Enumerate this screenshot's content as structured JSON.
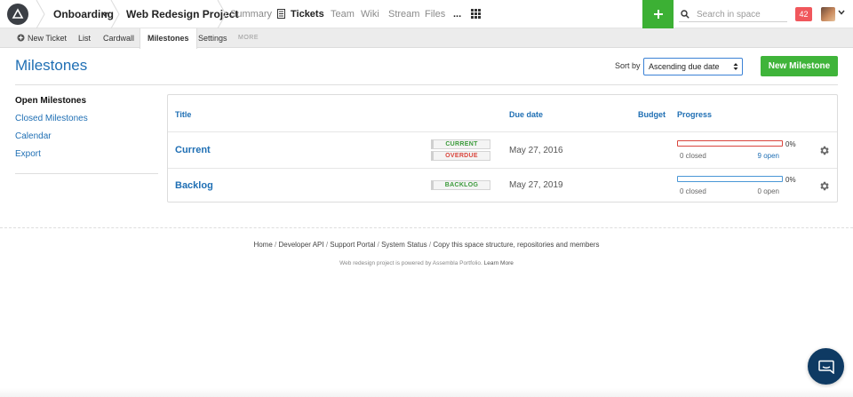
{
  "topbar": {
    "breadcrumbs": [
      "Onboarding",
      "Web Redesign Project"
    ],
    "nav": [
      {
        "label": "Summary",
        "active": false
      },
      {
        "label": "Tickets",
        "active": true
      },
      {
        "label": "Team",
        "active": false
      },
      {
        "label": "Wiki",
        "active": false
      },
      {
        "label": "Stream",
        "active": false
      },
      {
        "label": "Files",
        "active": false
      },
      {
        "label": "...",
        "active": false
      }
    ],
    "search_placeholder": "Search in space",
    "notification_count": "42",
    "plus_color": "#3cb034"
  },
  "subnav": {
    "new_ticket": "New Ticket",
    "items": [
      "List",
      "Cardwall",
      "Milestones",
      "Settings"
    ],
    "active": "Milestones",
    "more": "MORE"
  },
  "header": {
    "title": "Milestones",
    "sort_label": "Sort by",
    "sort_value": "Ascending due date",
    "new_button": "New Milestone"
  },
  "sidebar": {
    "items": [
      "Open Milestones",
      "Closed Milestones",
      "Calendar",
      "Export"
    ]
  },
  "table": {
    "columns": {
      "title": "Title",
      "due": "Due date",
      "budget": "Budget",
      "progress": "Progress"
    },
    "rows": [
      {
        "title": "Current",
        "tags": [
          "CURRENT",
          "OVERDUE"
        ],
        "due": "May 27, 2016",
        "progress": 0,
        "percent": "0%",
        "closed": "0 closed",
        "open": "9 open"
      },
      {
        "title": "Backlog",
        "tags": [
          "BACKLOG"
        ],
        "due": "May 27, 2019",
        "progress": 0,
        "percent": "0%",
        "closed": "0 closed",
        "open": "0 open"
      }
    ]
  },
  "footer": {
    "links": [
      "Home",
      "Developer API",
      "Support Portal",
      "System Status",
      "Copy this space structure, repositories and members"
    ],
    "note": "Web redesign project is powered by Assembla Portfolio.",
    "note_link": "Learn More"
  },
  "colors": {
    "brand_blue": "#1f6fb4",
    "green": "#3fb43a",
    "overdue_red": "#d9453c"
  }
}
